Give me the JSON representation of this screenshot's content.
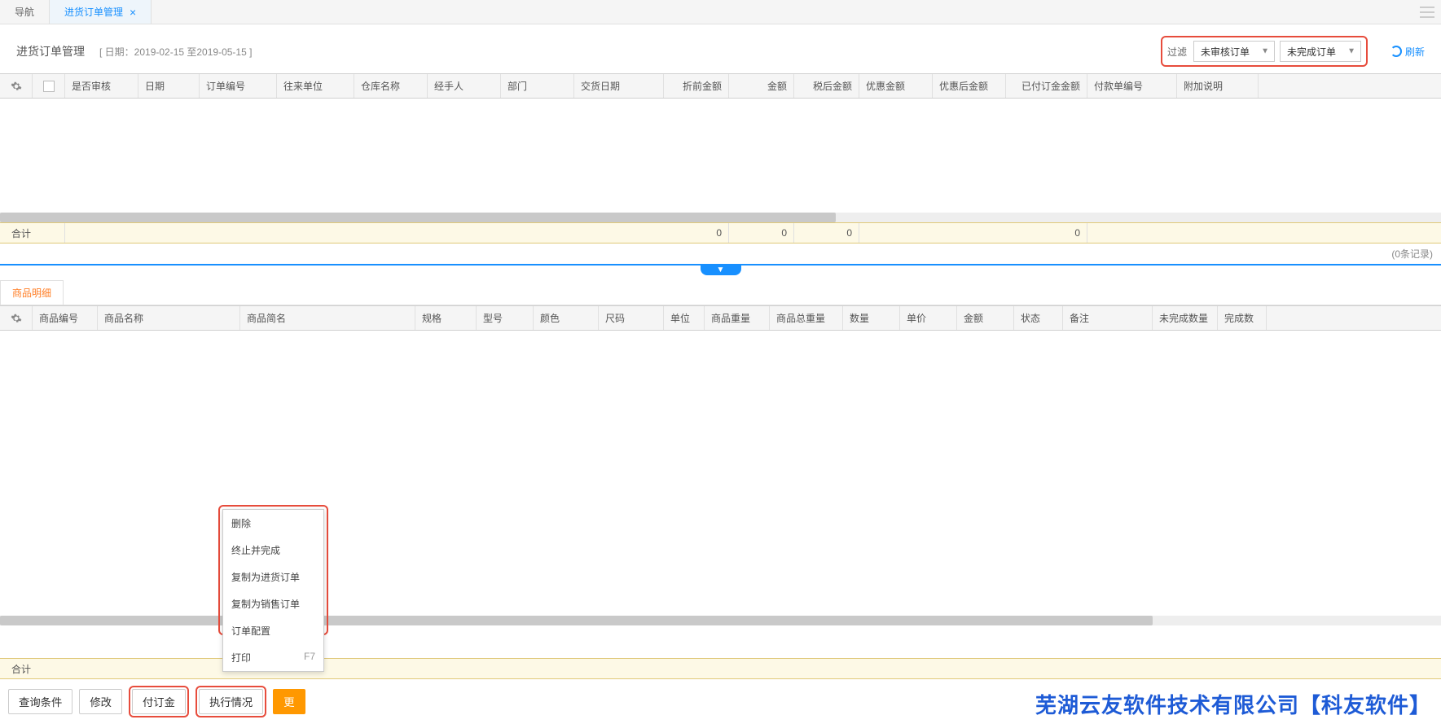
{
  "tabs": {
    "nav": "导航",
    "active": "进货订单管理"
  },
  "page_title": "进货订单管理",
  "date_range": "[ 日期：2019-02-15 至2019-05-15  ]",
  "filter": {
    "label": "过滤",
    "select1": "未审核订单",
    "select2": "未完成订单"
  },
  "refresh": "刷新",
  "top_table": {
    "columns": [
      "是否审核",
      "日期",
      "订单编号",
      "往来单位",
      "仓库名称",
      "经手人",
      "部门",
      "交货日期",
      "折前金额",
      "金额",
      "税后金额",
      "优惠金额",
      "优惠后金额",
      "已付订金金额",
      "付款单编号",
      "附加说明"
    ],
    "footer_label": "合计",
    "footer_values": {
      "preamt": "0",
      "amt": "0",
      "tax": "0",
      "deposit": "0"
    }
  },
  "records_text": "(0条记录)",
  "detail_tab": "商品明细",
  "detail_table": {
    "columns": [
      "商品编号",
      "商品名称",
      "商品简名",
      "规格",
      "型号",
      "颜色",
      "尺码",
      "单位",
      "商品重量",
      "商品总重量",
      "数量",
      "单价",
      "金额",
      "状态",
      "备注",
      "未完成数量",
      "完成数"
    ],
    "footer_label": "合计"
  },
  "context_menu": {
    "items": [
      "删除",
      "终止并完成",
      "复制为进货订单",
      "复制为销售订单",
      "订单配置"
    ],
    "print": "打印",
    "print_key": "F7"
  },
  "toolbar": {
    "query": "查询条件",
    "edit": "修改",
    "deposit": "付订金",
    "exec": "执行情况",
    "more": "更"
  },
  "watermark": "芜湖云友软件技术有限公司【科友软件】"
}
